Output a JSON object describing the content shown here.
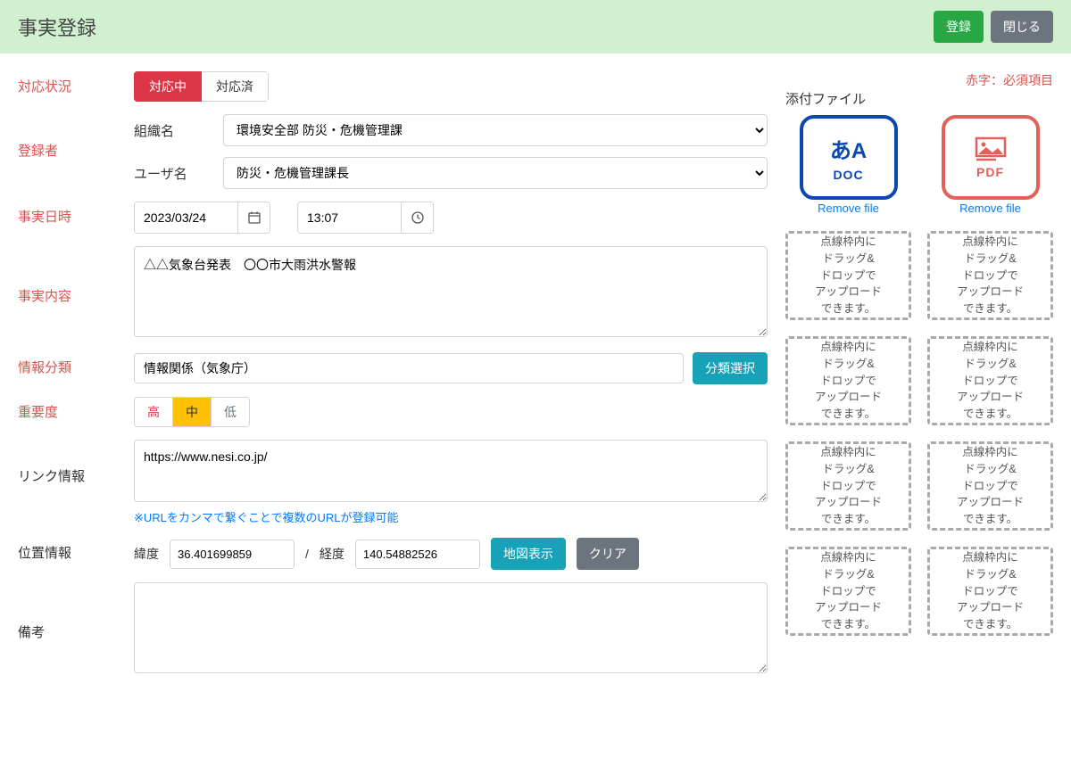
{
  "header": {
    "title": "事実登録",
    "register": "登録",
    "close": "閉じる"
  },
  "note_required": "赤字：必須項目",
  "labels": {
    "status": "対応状況",
    "registrant": "登録者",
    "datetime": "事実日時",
    "content": "事実内容",
    "category": "情報分類",
    "priority": "重要度",
    "link": "リンク情報",
    "location": "位置情報",
    "notes": "備考",
    "org": "組織名",
    "user": "ユーザ名",
    "lat": "緯度",
    "lon": "経度",
    "slash": "/"
  },
  "status": {
    "active": "対応中",
    "done": "対応済"
  },
  "registrant": {
    "org_value": "環境安全部 防災・危機管理課",
    "user_value": "防災・危機管理課長"
  },
  "datetime": {
    "date": "2023/03/24",
    "time": "13:07"
  },
  "content": "△△気象台発表　〇〇市大雨洪水警報",
  "category": {
    "value": "情報関係（気象庁）",
    "select_btn": "分類選択"
  },
  "priority": {
    "high": "高",
    "mid": "中",
    "low": "低"
  },
  "link": {
    "value": "https://www.nesi.co.jp/",
    "helper": "※URLをカンマで繋ぐことで複数のURLが登録可能"
  },
  "location": {
    "lat": "36.401699859",
    "lon": "140.54882526",
    "map_btn": "地図表示",
    "clear_btn": "クリア"
  },
  "notes": "",
  "attachments": {
    "title": "添付ファイル",
    "doc_glyph": "あA",
    "doc_ext": "DOC",
    "pdf_ext": "PDF",
    "remove": "Remove file",
    "drop_hint": "点線枠内に\nドラッグ&\nドロップで\nアップロード\nできます。"
  }
}
